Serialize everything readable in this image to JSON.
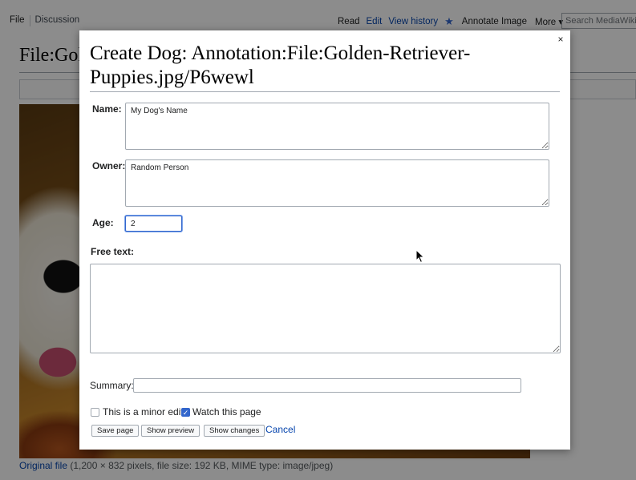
{
  "wiki": {
    "tabs_left": [
      "File",
      "Discussion"
    ],
    "tabs_right": [
      "Read",
      "Edit",
      "View history"
    ],
    "annotate": "Annotate Image",
    "more": "More",
    "search_placeholder": "Search MediaWiki",
    "page_title": "File:Golden-Retriever-Puppies.jpg",
    "caption_link": "Original file",
    "caption_rest": " (1,200 × 832 pixels, file size: 192 KB, MIME type: image/jpeg)"
  },
  "dialog": {
    "title": "Create Dog: Annotation:File:Golden-Retriever-Puppies.jpg/P6wewl",
    "name_label": "Name:",
    "name_value": "My Dog's Name",
    "owner_label": "Owner:",
    "owner_value": "Random Person",
    "age_label": "Age:",
    "age_value": "2",
    "free_text_label": "Free text:",
    "free_text_value": "",
    "summary_label": "Summary:",
    "summary_value": "",
    "minor_edit_label": "This is a minor edit",
    "minor_edit_checked": false,
    "watch_label": "Watch this page",
    "watch_checked": true,
    "save_label": "Save page",
    "preview_label": "Show preview",
    "changes_label": "Show changes",
    "cancel_label": "Cancel",
    "close_symbol": "×"
  },
  "colors": {
    "link": "#0645ad",
    "accent": "#3366cc",
    "overlay": "rgba(0,0,0,0.45)"
  }
}
